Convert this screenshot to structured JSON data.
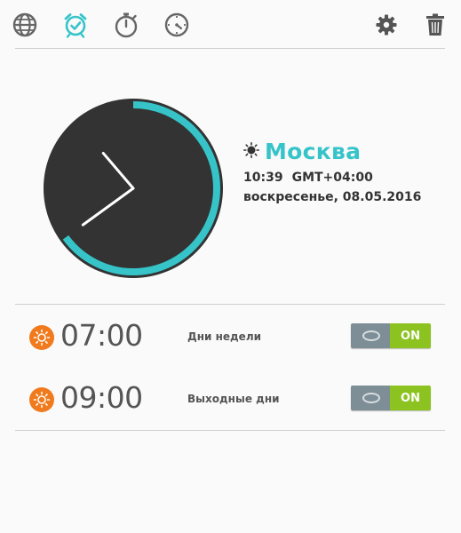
{
  "toolbar": {
    "icons": [
      "globe-icon",
      "alarm-clock-icon",
      "stopwatch-icon",
      "timer-icon",
      "gear-icon",
      "trash-icon"
    ],
    "active_color": "#36c4c9",
    "inactive_color": "#666666"
  },
  "world_clock": {
    "city": "Москва",
    "time": "10:39",
    "timezone": "GMT+04:00",
    "date": "воскресенье, 08.05.2016",
    "accent_color": "#36c4c9",
    "hour": 10,
    "minute": 39
  },
  "alarms": [
    {
      "time": "07:00",
      "label": "Дни недели",
      "toggle_label": "ON",
      "enabled": true
    },
    {
      "time": "09:00",
      "label": "Выходные дни",
      "toggle_label": "ON",
      "enabled": true
    }
  ],
  "colors": {
    "alarm_icon": "#f07a1c",
    "toggle_on": "#8cc321",
    "toggle_off": "#7d8e96",
    "clock_face": "#333333"
  }
}
